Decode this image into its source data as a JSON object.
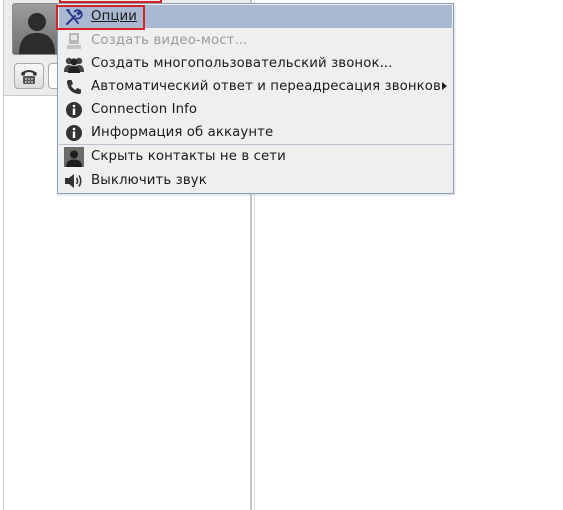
{
  "menu": {
    "items": [
      {
        "label": "Опции",
        "icon": "wrench-icon",
        "active": true
      },
      {
        "label": "Создать видео-мост...",
        "icon": "video-bridge-icon",
        "disabled": true
      },
      {
        "label": "Создать многопользовательский звонок...",
        "icon": "conference-icon"
      },
      {
        "label": "Автоматический ответ и переадресация звонков",
        "icon": "phone-icon",
        "submenu": true
      },
      {
        "label": "Connection Info",
        "icon": "info-icon"
      },
      {
        "label": "Информация об аккаунте",
        "icon": "info-icon"
      },
      {
        "label": "Скрыть контакты не в сети",
        "icon": "user-icon"
      },
      {
        "label": "Выключить звук",
        "icon": "speaker-icon"
      }
    ]
  },
  "colors": {
    "highlight": "#a9b9d2",
    "annotation_red": "#d2232a",
    "menu_bg": "#efefef"
  }
}
